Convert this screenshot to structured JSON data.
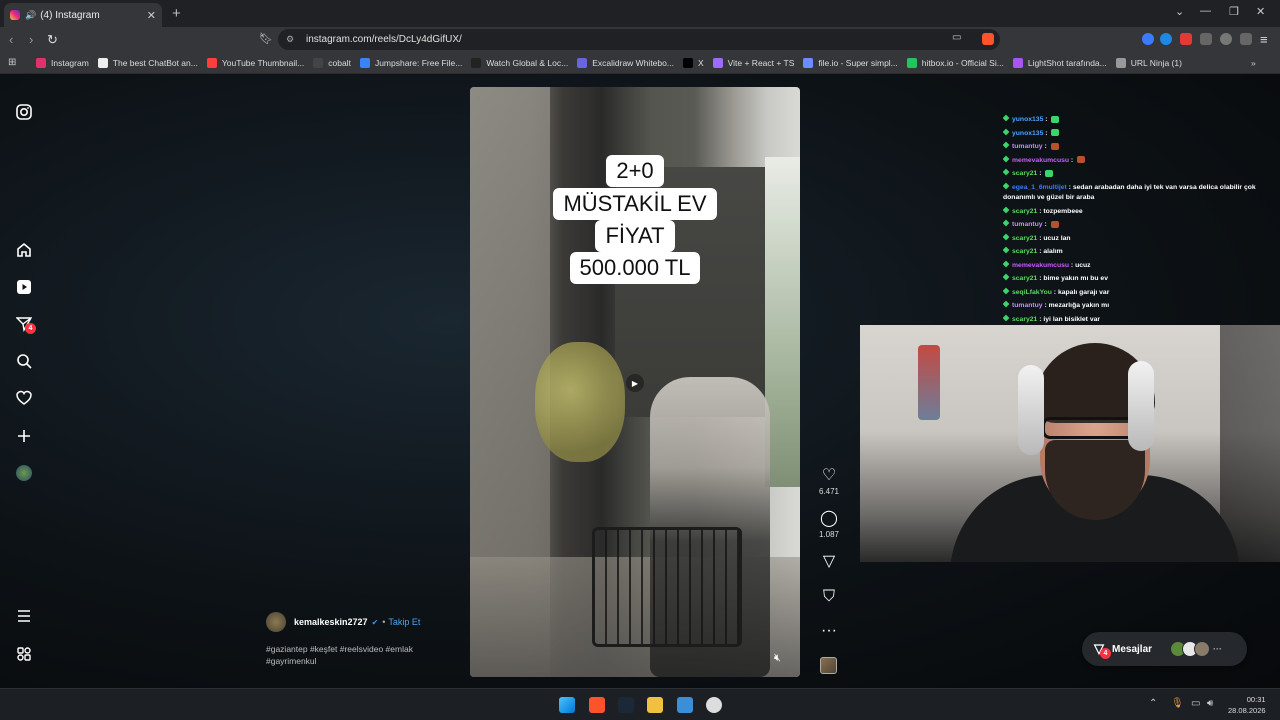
{
  "browser": {
    "tab_title": "(4) Instagram",
    "url": "instagram.com/reels/DcLy4dGifUX/",
    "bookmarks": [
      {
        "label": "Instagram",
        "color": "#e1306c"
      },
      {
        "label": "The best ChatBot an...",
        "color": "#eeeeee"
      },
      {
        "label": "YouTube Thumbnail...",
        "color": "#ff3d3d"
      },
      {
        "label": "cobalt",
        "color": "#444444"
      },
      {
        "label": "Jumpshare: Free File...",
        "color": "#3b82f6"
      },
      {
        "label": "Watch Global & Loc...",
        "color": "#222222"
      },
      {
        "label": "Excalidraw Whitebo...",
        "color": "#6965db"
      },
      {
        "label": "X",
        "color": "#000000"
      },
      {
        "label": "Vite + React + TS",
        "color": "#9d6bff"
      },
      {
        "label": "file.io - Super simpl...",
        "color": "#6c8cff"
      },
      {
        "label": "hitbox.io - Official Si...",
        "color": "#22c55e"
      },
      {
        "label": "LightShot tarafında...",
        "color": "#a855f7"
      },
      {
        "label": "URL Ninja (1)",
        "color": "#999999"
      }
    ]
  },
  "sidebar": {
    "notifications_badge": "4"
  },
  "reel": {
    "caption_lines": [
      "2+0",
      "MÜSTAKİL EV",
      "FİYAT",
      "500.000 TL"
    ],
    "likes": "6.471",
    "comments": "1.087",
    "author": "kemalkeskin2727",
    "follow_label": "Takip Et",
    "tags": "#gaziantep #keşfet #reelsvideo #emlak #gayrimenkul"
  },
  "chat": [
    {
      "user": "yunox135",
      "msg": "",
      "color": "#4fa3ff",
      "emote": "#3bd66b"
    },
    {
      "user": "yunox135",
      "msg": "",
      "color": "#4fa3ff",
      "emote": "#3bd66b"
    },
    {
      "user": "tumantuy",
      "msg": "",
      "color": "#c78cff",
      "emote": "#b5512f"
    },
    {
      "user": "memevakumcusu",
      "msg": "",
      "color": "#c85cff",
      "emote": "#b5512f"
    },
    {
      "user": "scary21",
      "msg": "",
      "color": "#5bdc5b",
      "emote": "#3bd66b"
    },
    {
      "user": "egea_1_6multijet",
      "msg": "sedan arabadan daha iyi tek van varsa delica olabilir çok donanımlı ve güzel bir araba",
      "color": "#3a7bff",
      "emote": ""
    },
    {
      "user": "scary21",
      "msg": "tozpembeee",
      "color": "#5bdc5b",
      "emote": ""
    },
    {
      "user": "tumantuy",
      "msg": "",
      "color": "#c78cff",
      "emote": "#b5512f"
    },
    {
      "user": "scary21",
      "msg": "ucuz lan",
      "color": "#5bdc5b",
      "emote": ""
    },
    {
      "user": "scary21",
      "msg": "alalım",
      "color": "#5bdc5b",
      "emote": ""
    },
    {
      "user": "memevakumcusu",
      "msg": "ucuz",
      "color": "#c85cff",
      "emote": ""
    },
    {
      "user": "scary21",
      "msg": "bime yakın mı bu ev",
      "color": "#5bdc5b",
      "emote": ""
    },
    {
      "user": "seqiLfakYou",
      "msg": "kapalı garajı var",
      "color": "#5bdc5b",
      "emote": ""
    },
    {
      "user": "tumantuy",
      "msg": "mezarlığa yakın mı",
      "color": "#c78cff",
      "emote": ""
    },
    {
      "user": "scary21",
      "msg": "iyi lan bisiklet var",
      "color": "#5bdc5b",
      "emote": ""
    }
  ],
  "messages_pill": {
    "label": "Mesajlar",
    "badge": "4"
  },
  "clock": {
    "time": "00:31",
    "date": "28.08.2026"
  }
}
